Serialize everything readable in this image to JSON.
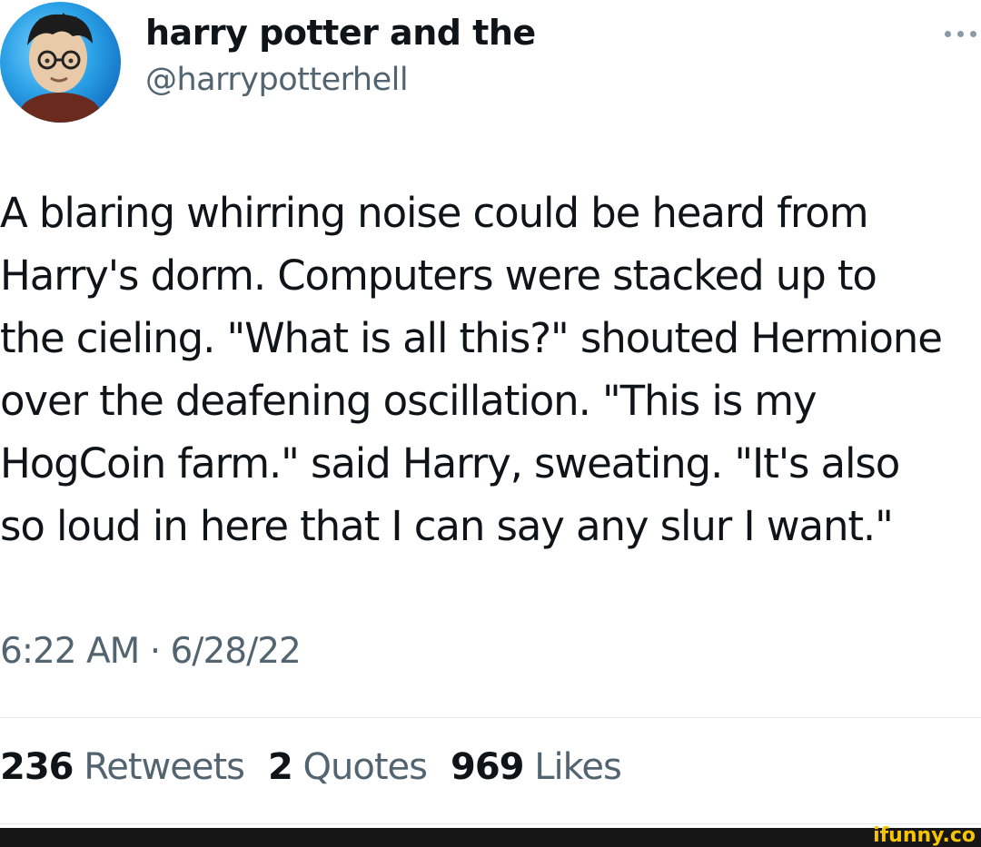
{
  "tweet": {
    "author": {
      "display_name": "harry potter and the",
      "handle": "@harrypotterhell",
      "avatar_icon": "avatar-image"
    },
    "more_icon": "more-horizontal-icon",
    "text_lines": [
      "A blaring whirring noise could be heard from",
      "Harry's dorm. Computers were stacked up to",
      "the cieling. \"What is all this?\" shouted Hermione",
      "over the deafening oscillation. \"This is my",
      "HogCoin farm.\" said Harry, sweating. \"It's also",
      "so loud in here that I can say any slur I want.\""
    ],
    "timestamp": "6:22 AM · 6/28/22",
    "stats": {
      "retweets": {
        "count": "236",
        "label": "Retweets"
      },
      "quotes": {
        "count": "2",
        "label": "Quotes"
      },
      "likes": {
        "count": "969",
        "label": "Likes"
      }
    }
  },
  "watermark": {
    "text": "ifunny.co"
  },
  "colors": {
    "text_primary": "#0f1419",
    "text_secondary": "#536471",
    "divider": "#e6e9eb",
    "watermark": "#f6c400",
    "footer_bar": "#161616"
  }
}
